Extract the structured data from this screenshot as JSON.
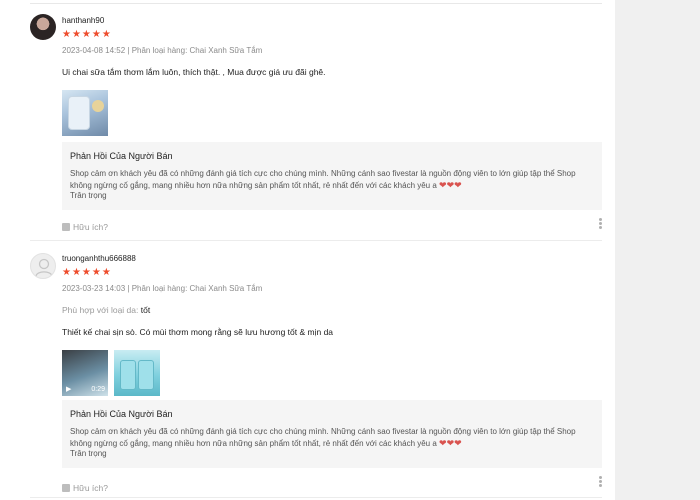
{
  "reviews": [
    {
      "username": "hanthanh90",
      "rating": 5,
      "stars": "★★★★★",
      "meta": "2023-04-08 14:52 | Phân loại hàng: Chai Xanh Sữa Tắm",
      "comment": "Ui chai sữa tắm thơm lắm luôn, thích thật. , Mua được giá ưu đãi ghê.",
      "seller_title": "Phản Hồi Của Người Bán",
      "seller_text": "Shop cảm ơn khách yêu đã có những đánh giá tích cực cho chúng mình. Những cánh sao fivestar là nguồn động viên to lớn giúp tập thể Shop không ngừng cố gắng, mang nhiều hơn nữa những sản phẩm tốt nhất, rẻ nhất đến với các khách yêu a",
      "seller_hearts": "❤❤❤",
      "seller_sign": "Trân trọng",
      "helpful": "Hữu ích?"
    },
    {
      "username": "truonganhthu666888",
      "rating": 5,
      "stars": "★★★★★",
      "meta": "2023-03-23 14:03 | Phân loại hàng: Chai Xanh Sữa Tắm",
      "attr_key": "Phù hợp với loại da:",
      "attr_value": "tốt",
      "comment": "Thiết kế chai sịn sò. Có mùi thơm mong rằng sẽ lưu hương tốt & mịn da",
      "video_duration": "0:29",
      "seller_title": "Phản Hồi Của Người Bán",
      "seller_text": "Shop cảm ơn khách yêu đã có những đánh giá tích cực cho chúng mình. Những cánh sao fivestar là nguồn động viên to lớn giúp tập thể Shop không ngừng cố gắng, mang nhiều hơn nữa những sản phẩm tốt nhất, rẻ nhất đến với các khách yêu a",
      "seller_hearts": "❤❤❤",
      "seller_sign": "Trân trọng",
      "helpful": "Hữu ích?"
    }
  ],
  "icons": {
    "play": "▶",
    "star_color": "#ee4d2d",
    "heart_color": "#d9534f"
  }
}
